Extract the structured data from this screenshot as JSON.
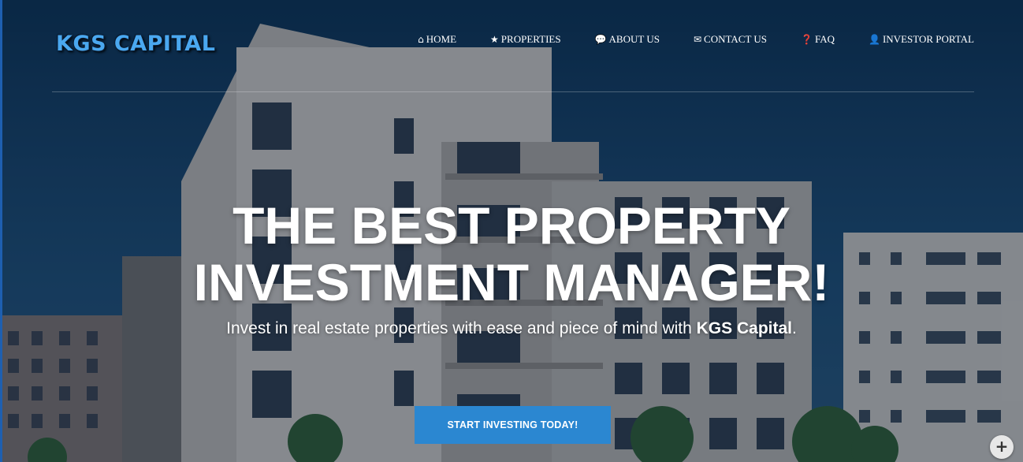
{
  "brand": {
    "name": "KGS CAPITAL"
  },
  "nav": {
    "items": [
      {
        "icon": "home-icon",
        "label": "HOME"
      },
      {
        "icon": "star-icon",
        "label": "PROPERTIES"
      },
      {
        "icon": "comment-icon",
        "label": "ABOUT US"
      },
      {
        "icon": "envelope-icon",
        "label": "CONTACT US"
      },
      {
        "icon": "question-circle-icon",
        "label": "FAQ"
      },
      {
        "icon": "user-icon",
        "label": "INVESTOR PORTAL"
      }
    ]
  },
  "hero": {
    "headline_line1": "THE BEST PROPERTY",
    "headline_line2": "INVESTMENT MANAGER!",
    "subline_before": "Invest in real estate properties with ease and piece of mind with ",
    "subline_brand": "KGS Capital",
    "subline_after": ".",
    "cta_label": "START INVESTING TODAY!"
  },
  "floating_button": {
    "icon": "plus-icon",
    "label": "+"
  },
  "colors": {
    "accent": "#2b87d1",
    "logo": "#4aa8f0",
    "background": "#163f63"
  }
}
